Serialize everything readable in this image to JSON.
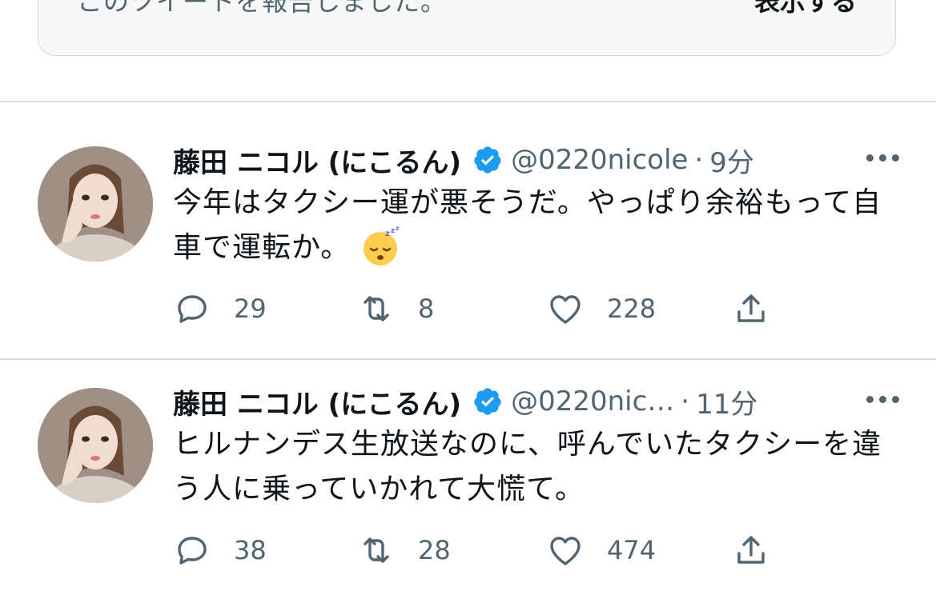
{
  "notice": {
    "text": "このツイートを報告しました。",
    "link_label": "表示する"
  },
  "tweets": [
    {
      "name": "藤田 ニコル (にこるん)",
      "handle": "@0220nicole",
      "separator": "·",
      "time": "9分",
      "text": "今年はタクシー運が悪そうだ。やっぱり余裕もって自車で運転か。",
      "emoji": "sleeping-face",
      "replies": "29",
      "retweets": "8",
      "likes": "228"
    },
    {
      "name": "藤田 ニコル (にこるん)",
      "handle": "@0220nic…",
      "separator": "·",
      "time": "11分",
      "text": "ヒルナンデス生放送なのに、呼んでいたタクシーを違う人に乗っていかれて大慌て。",
      "replies": "38",
      "retweets": "28",
      "likes": "474"
    }
  ],
  "colors": {
    "verified": "#1d9bf0",
    "secondary_text": "#536471",
    "divider": "#d9dee2"
  }
}
